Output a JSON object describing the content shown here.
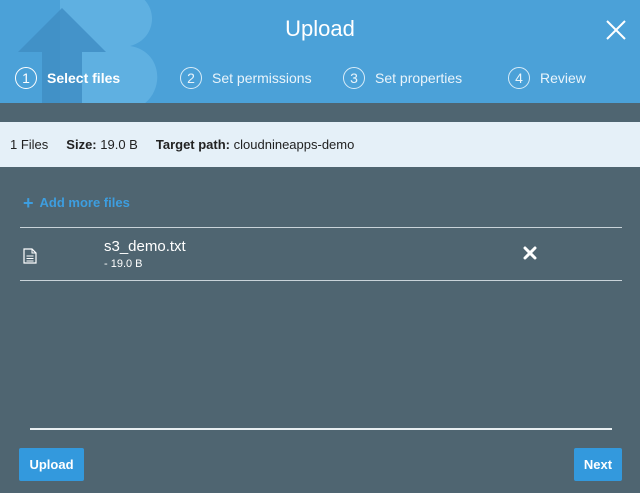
{
  "dialog": {
    "title": "Upload",
    "steps": [
      {
        "number": "1",
        "label": "Select files",
        "active": true
      },
      {
        "number": "2",
        "label": "Set permissions",
        "active": false
      },
      {
        "number": "3",
        "label": "Set properties",
        "active": false
      },
      {
        "number": "4",
        "label": "Review",
        "active": false
      }
    ]
  },
  "info_bar": {
    "files_count": "1 Files",
    "size_label": "Size:",
    "size_value": "19.0 B",
    "target_label": "Target path:",
    "target_value": "cloudnineapps-demo"
  },
  "files": {
    "add_more_label": "Add more files",
    "items": [
      {
        "name": "s3_demo.txt",
        "size": "- 19.0 B",
        "icon": "document-icon"
      }
    ]
  },
  "footer": {
    "upload_label": "Upload",
    "next_label": "Next"
  },
  "colors": {
    "header": "#4ba1d8",
    "body": "#4f6571",
    "info_bar": "#e5f0f8",
    "button": "#3399dd",
    "link": "#3d9ee0"
  }
}
